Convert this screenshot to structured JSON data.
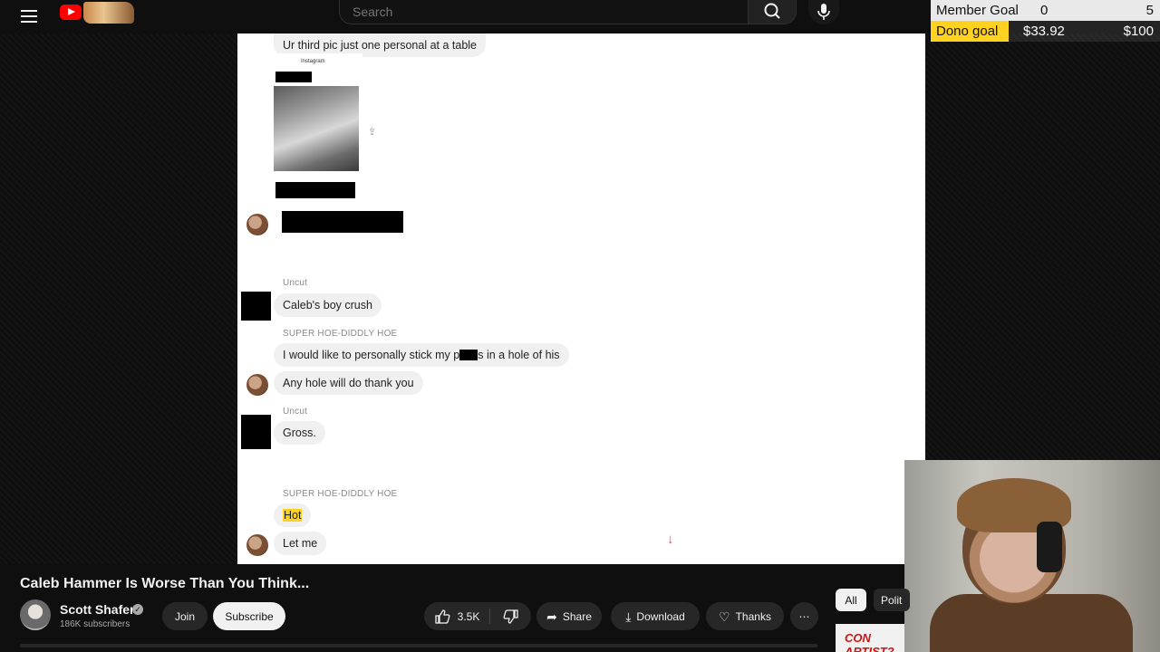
{
  "header": {
    "search_placeholder": "Search",
    "menu_icon": "hamburger-menu-icon",
    "search_icon": "search-icon",
    "mic_icon": "microphone-icon"
  },
  "goals": {
    "member": {
      "label": "Member Goal",
      "current": "0",
      "target": "5"
    },
    "dono": {
      "label": "Dono goal",
      "current": "$33.92",
      "target": "$100"
    }
  },
  "chat": {
    "top_message": "Ur third pic just one personal at a table",
    "uncut_1": {
      "sender": "Uncut",
      "text": "Caleb's boy crush"
    },
    "hoe_1": {
      "sender": "SUPER HOE-DIDDLY HOE",
      "text_a": "I would like to personally stick my p",
      "text_b": "s in a hole of his"
    },
    "hoe_2": {
      "text": "Any hole will do thank you"
    },
    "uncut_2": {
      "sender": "Uncut",
      "text": "Gross."
    },
    "hoe_3": {
      "sender": "SUPER HOE-DIDDLY HOE",
      "text": "Hot"
    },
    "hoe_4": {
      "text": "Let me"
    },
    "shot_title": "Instagram",
    "scroll_icon": "arrow-down-icon"
  },
  "video": {
    "title": "Caleb Hammer Is Worse Than You Think...",
    "channel": "Scott Shafer",
    "subscribers": "186K subscribers",
    "join": "Join",
    "subscribe": "Subscribe",
    "likes": "3.5K",
    "share": "Share",
    "download": "Download",
    "thanks": "Thanks",
    "more": "⋯"
  },
  "chips": {
    "all": "All",
    "other": "Polit"
  },
  "thumbnail_text": "CON ARTIST?",
  "colors": {
    "accent_yellow": "#ffd21f",
    "brand_red": "#ff0000",
    "scroll_pink": "#e04895"
  }
}
